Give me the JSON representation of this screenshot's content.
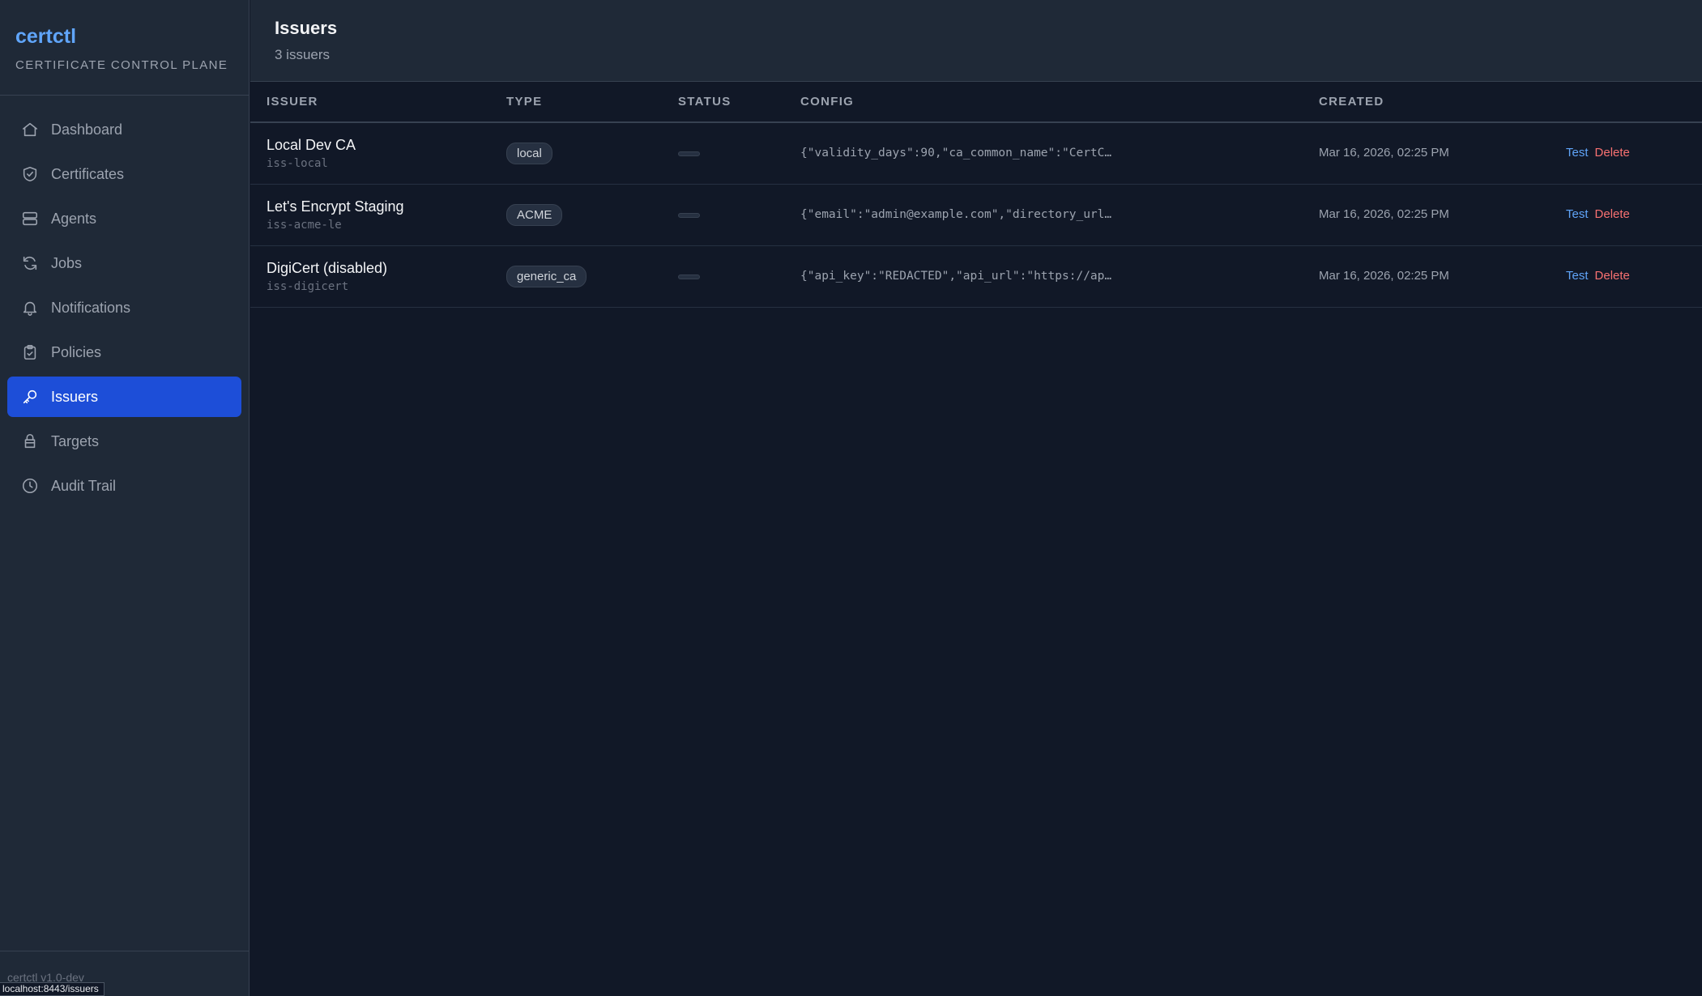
{
  "brand": {
    "name": "certctl",
    "tagline": "CERTIFICATE CONTROL PLANE"
  },
  "nav": [
    {
      "label": "Dashboard",
      "icon": "home-icon",
      "active": false
    },
    {
      "label": "Certificates",
      "icon": "shield-check-icon",
      "active": false
    },
    {
      "label": "Agents",
      "icon": "server-icon",
      "active": false
    },
    {
      "label": "Jobs",
      "icon": "refresh-icon",
      "active": false
    },
    {
      "label": "Notifications",
      "icon": "bell-icon",
      "active": false
    },
    {
      "label": "Policies",
      "icon": "clipboard-check-icon",
      "active": false
    },
    {
      "label": "Issuers",
      "icon": "key-icon",
      "active": true
    },
    {
      "label": "Targets",
      "icon": "database-icon",
      "active": false
    },
    {
      "label": "Audit Trail",
      "icon": "clock-icon",
      "active": false
    }
  ],
  "footer": {
    "version": "certctl v1.0-dev",
    "status_url": "localhost:8443/issuers"
  },
  "page": {
    "title": "Issuers",
    "subtitle": "3 issuers"
  },
  "table": {
    "columns": [
      "ISSUER",
      "TYPE",
      "STATUS",
      "CONFIG",
      "CREATED"
    ],
    "rows": [
      {
        "name": "Local Dev CA",
        "id": "iss-local",
        "type": "local",
        "config": "{\"validity_days\":90,\"ca_common_name\":\"CertC…",
        "created": "Mar 16, 2026, 02:25 PM",
        "test_label": "Test",
        "delete_label": "Delete"
      },
      {
        "name": "Let's Encrypt Staging",
        "id": "iss-acme-le",
        "type": "ACME",
        "config": "{\"email\":\"admin@example.com\",\"directory_url…",
        "created": "Mar 16, 2026, 02:25 PM",
        "test_label": "Test",
        "delete_label": "Delete"
      },
      {
        "name": "DigiCert (disabled)",
        "id": "iss-digicert",
        "type": "generic_ca",
        "config": "{\"api_key\":\"REDACTED\",\"api_url\":\"https://ap…",
        "created": "Mar 16, 2026, 02:25 PM",
        "test_label": "Test",
        "delete_label": "Delete"
      }
    ]
  },
  "colors": {
    "accent": "#1d4ed8",
    "brand": "#60a5fa",
    "danger": "#f87171",
    "background": "#111827",
    "sidebar": "#1f2937"
  }
}
